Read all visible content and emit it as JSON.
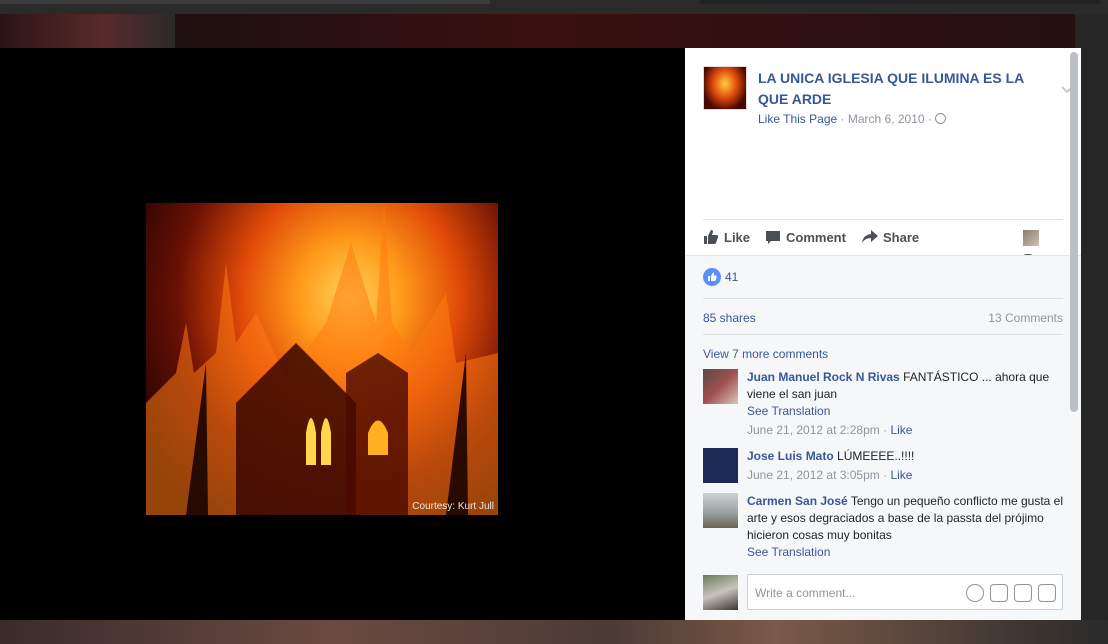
{
  "photo": {
    "credit": "Courtesy: Kurt Jull"
  },
  "post": {
    "page_name": "LA UNICA IGLESIA QUE ILUMINA ES LA QUE ARDE",
    "like_page": "Like This Page",
    "date": "March 6, 2010",
    "separator": " · "
  },
  "actions": {
    "like": "Like",
    "comment": "Comment",
    "share": "Share"
  },
  "stats": {
    "reactions": "41",
    "shares": "85 shares",
    "comments": "13 Comments"
  },
  "view_more": "View 7 more comments",
  "comments": [
    {
      "author": "Juan Manuel Rock N Rivas",
      "text": "FANTÁSTICO ... ahora que viene el san juan",
      "see_translation": "See Translation",
      "time": "June 21, 2012 at 2:28pm",
      "like": "Like"
    },
    {
      "author": "Jose Luis Mato",
      "text": "LÚMEEEE..!!!!",
      "time": "June 21, 2012 at 3:05pm",
      "like": "Like"
    },
    {
      "author": "Carmen San José",
      "text": "Tengo un pequeño conflicto me gusta el arte y esos degraciados a base de la passta del prójimo hicieron cosas muy bonitas",
      "see_translation": "See Translation"
    }
  ],
  "composer": {
    "placeholder": "Write a comment..."
  },
  "colors": {
    "link": "#365899",
    "like_badge": "#5890ff"
  }
}
